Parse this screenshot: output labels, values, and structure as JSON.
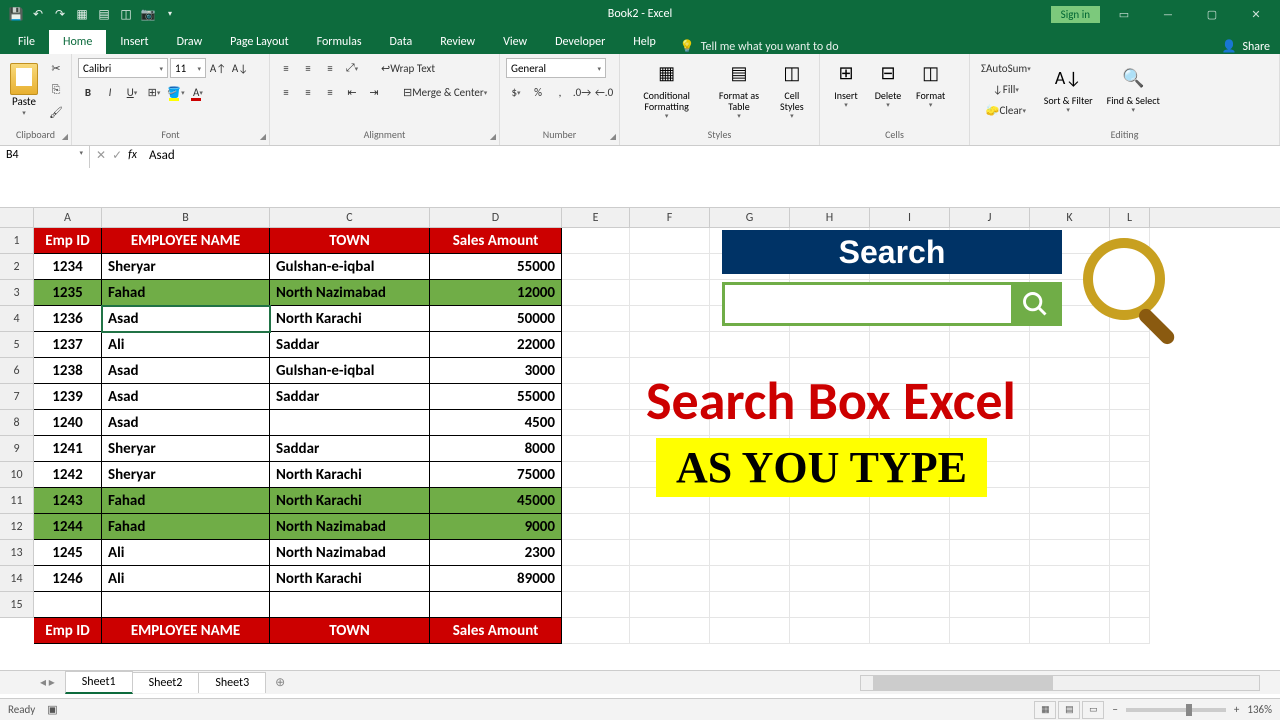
{
  "titlebar": {
    "title": "Book2 - Excel",
    "signin": "Sign in"
  },
  "tabs": {
    "file": "File",
    "home": "Home",
    "insert": "Insert",
    "draw": "Draw",
    "pageLayout": "Page Layout",
    "formulas": "Formulas",
    "data": "Data",
    "review": "Review",
    "view": "View",
    "developer": "Developer",
    "help": "Help",
    "tellMe": "Tell me what you want to do",
    "share": "Share"
  },
  "ribbon": {
    "paste": "Paste",
    "clipboard": "Clipboard",
    "fontName": "Calibri",
    "fontSize": "11",
    "font": "Font",
    "wrapText": "Wrap Text",
    "mergeCenter": "Merge & Center",
    "alignment": "Alignment",
    "general": "General",
    "number": "Number",
    "condFmt": "Conditional Formatting",
    "formatTable": "Format as Table",
    "cellStyles": "Cell Styles",
    "styles": "Styles",
    "insert": "Insert",
    "delete": "Delete",
    "format": "Format",
    "cells": "Cells",
    "autosum": "AutoSum",
    "fill": "Fill",
    "clear": "Clear",
    "sortFilter": "Sort & Filter",
    "findSelect": "Find & Select",
    "editing": "Editing"
  },
  "formulaBar": {
    "nameBox": "B4",
    "formula": "Asad"
  },
  "columns": [
    "A",
    "B",
    "C",
    "D",
    "E",
    "F",
    "G",
    "H",
    "I",
    "J",
    "K",
    "L"
  ],
  "headers": {
    "empId": "Emp ID",
    "empName": "EMPLOYEE NAME",
    "town": "TOWN",
    "sales": "Sales  Amount"
  },
  "rows": [
    {
      "id": "1234",
      "name": "Sheryar",
      "town": "Gulshan-e-iqbal",
      "sales": "55000",
      "hl": false
    },
    {
      "id": "1235",
      "name": "Fahad",
      "town": "North Nazimabad",
      "sales": "12000",
      "hl": true
    },
    {
      "id": "1236",
      "name": "Asad",
      "town": "North Karachi",
      "sales": "50000",
      "hl": false
    },
    {
      "id": "1237",
      "name": "Ali",
      "town": "Saddar",
      "sales": "22000",
      "hl": false
    },
    {
      "id": "1238",
      "name": "Asad",
      "town": "Gulshan-e-iqbal",
      "sales": "3000",
      "hl": false
    },
    {
      "id": "1239",
      "name": "Asad",
      "town": "Saddar",
      "sales": "55000",
      "hl": false
    },
    {
      "id": "1240",
      "name": "Asad",
      "town": "",
      "sales": "4500",
      "hl": false
    },
    {
      "id": "1241",
      "name": "Sheryar",
      "town": "Saddar",
      "sales": "8000",
      "hl": false
    },
    {
      "id": "1242",
      "name": "Sheryar",
      "town": "North Karachi",
      "sales": "75000",
      "hl": false
    },
    {
      "id": "1243",
      "name": "Fahad",
      "town": "North Karachi",
      "sales": "45000",
      "hl": true
    },
    {
      "id": "1244",
      "name": "Fahad",
      "town": "North Nazimabad",
      "sales": "9000",
      "hl": true
    },
    {
      "id": "1245",
      "name": "Ali",
      "town": "North Nazimabad",
      "sales": "2300",
      "hl": false
    },
    {
      "id": "1246",
      "name": "Ali",
      "town": "North Karachi",
      "sales": "89000",
      "hl": false
    }
  ],
  "overlay": {
    "searchBanner": "Search",
    "title1": "Search Box Excel",
    "title2": "AS YOU TYPE"
  },
  "sheets": {
    "s1": "Sheet1",
    "s2": "Sheet2",
    "s3": "Sheet3"
  },
  "status": {
    "ready": "Ready",
    "zoom": "136%"
  }
}
